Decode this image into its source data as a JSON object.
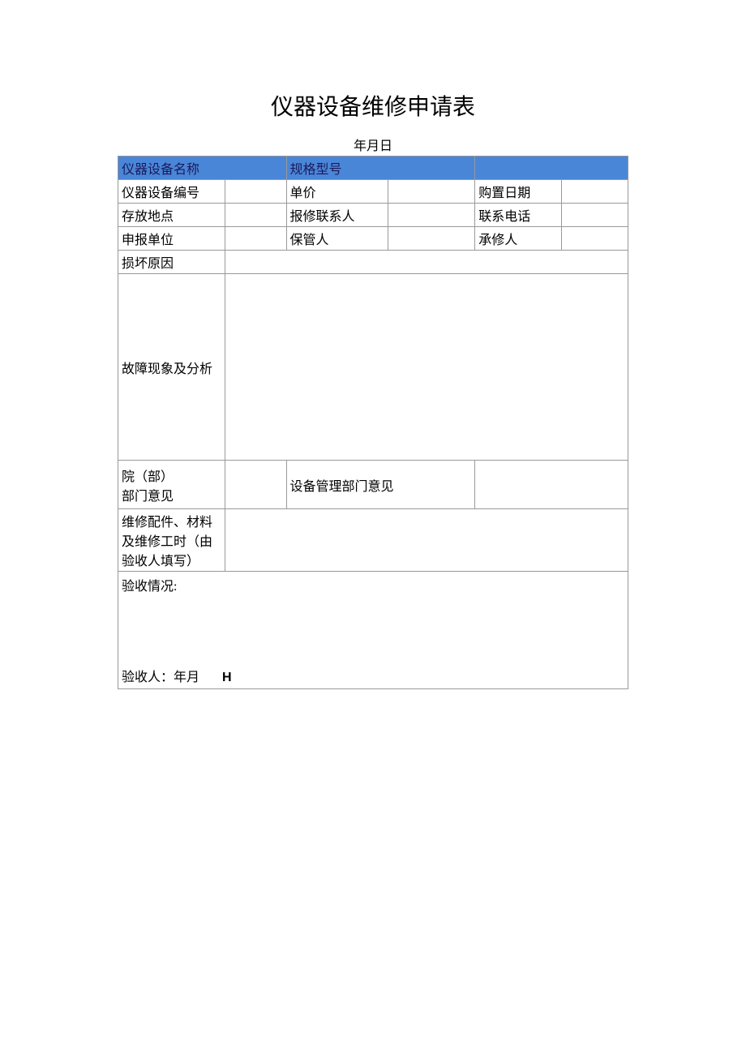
{
  "title": "仪器设备维修申请表",
  "date_line": "年月日",
  "labels": {
    "device_name": "仪器设备名称",
    "spec_model": "规格型号",
    "device_no": "仪器设备编号",
    "unit_price": "单价",
    "purchase_date": "购置日期",
    "storage_location": "存放地点",
    "repair_contact": "报修联系人",
    "contact_phone": "联系电话",
    "report_unit": "申报单位",
    "custodian": "保管人",
    "repairer": "承修人",
    "damage_reason": "损坏原因",
    "fault_analysis": "故障现象及分析",
    "dept_opinion_line1": "院（部）",
    "dept_opinion_line2": "部门意见",
    "mgmt_opinion": "设备管理部门意见",
    "parts_line1": "维修配件、材料",
    "parts_line2": "及维修工时（由",
    "parts_line3": "验收人填写）",
    "accept_status": "验收情况:",
    "accept_person": "验收人：年月",
    "h_char": "H"
  },
  "values": {
    "device_name": "",
    "spec_model": "",
    "device_no": "",
    "unit_price": "",
    "purchase_date": "",
    "storage_location": "",
    "repair_contact": "",
    "contact_phone": "",
    "report_unit": "",
    "custodian": "",
    "repairer": "",
    "damage_reason": "",
    "fault_analysis": "",
    "dept_opinion": "",
    "mgmt_opinion": "",
    "parts_info": "",
    "accept_status_text": ""
  }
}
